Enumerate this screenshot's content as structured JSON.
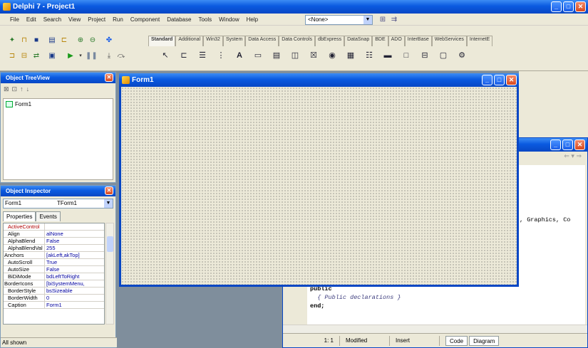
{
  "main_window": {
    "title": "Delphi 7 - Project1",
    "menu": [
      "File",
      "Edit",
      "Search",
      "View",
      "Project",
      "Run",
      "Component",
      "Database",
      "Tools",
      "Window",
      "Help"
    ],
    "combo_value": "<None>"
  },
  "palette": {
    "tabs": [
      "Standard",
      "Additional",
      "Win32",
      "System",
      "Data Access",
      "Data Controls",
      "dbExpress",
      "DataSnap",
      "BDE",
      "ADO",
      "InterBase",
      "WebServices",
      "InternetE"
    ],
    "active_tab": "Standard"
  },
  "object_treeview": {
    "title": "Object TreeView",
    "items": [
      "Form1"
    ]
  },
  "object_inspector": {
    "title": "Object Inspector",
    "selected_object": "Form1",
    "selected_type": "TForm1",
    "tabs": [
      "Properties",
      "Events"
    ],
    "properties": [
      {
        "name": "ActiveControl",
        "value": "",
        "red": true,
        "expand": false
      },
      {
        "name": "Align",
        "value": "alNone",
        "red": false,
        "expand": false
      },
      {
        "name": "AlphaBlend",
        "value": "False",
        "red": false,
        "expand": false
      },
      {
        "name": "AlphaBlendVal",
        "value": "255",
        "red": false,
        "expand": false
      },
      {
        "name": "Anchors",
        "value": "[akLeft,akTop]",
        "red": false,
        "expand": true
      },
      {
        "name": "AutoScroll",
        "value": "True",
        "red": false,
        "expand": false
      },
      {
        "name": "AutoSize",
        "value": "False",
        "red": false,
        "expand": false
      },
      {
        "name": "BiDiMode",
        "value": "bdLeftToRight",
        "red": false,
        "expand": false
      },
      {
        "name": "BorderIcons",
        "value": "[biSystemMenu,",
        "red": false,
        "expand": true
      },
      {
        "name": "BorderStyle",
        "value": "bsSizeable",
        "red": false,
        "expand": false
      },
      {
        "name": "BorderWidth",
        "value": "0",
        "red": false,
        "expand": false
      },
      {
        "name": "Caption",
        "value": "Form1",
        "red": false,
        "expand": false
      }
    ],
    "status": "All shown"
  },
  "form_designer": {
    "title": "Form1"
  },
  "code_editor": {
    "visible_code": [
      ", Graphics, Co",
      "public",
      "  { Public declarations }",
      "end;"
    ],
    "status": {
      "position": "1: 1",
      "state": "Modified",
      "mode": "Insert"
    },
    "bottom_tabs": [
      "Code",
      "Diagram"
    ]
  },
  "colors": {
    "xp_blue": "#0a5ae0",
    "face": "#ece9d8",
    "desktop": "#7f8e9c"
  }
}
